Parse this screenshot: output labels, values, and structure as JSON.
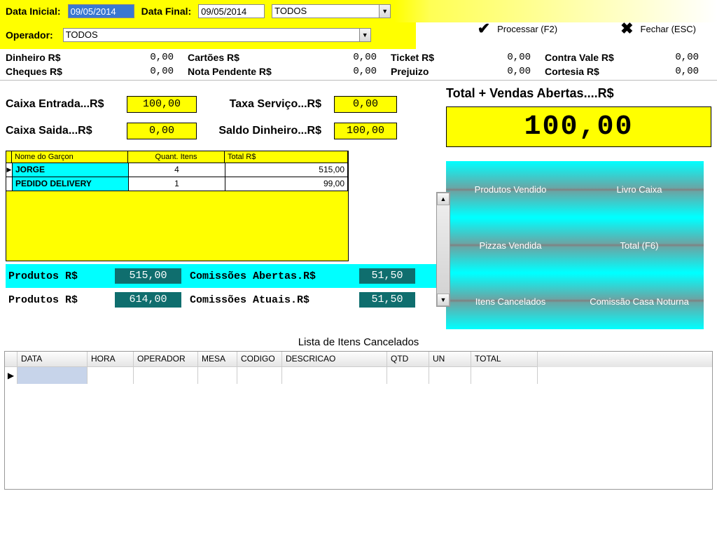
{
  "filters": {
    "data_inicial_label": "Data Inicial:",
    "data_inicial_value": "09/05/2014",
    "data_final_label": "Data Final:",
    "data_final_value": "09/05/2014",
    "tipo_value": "TODOS",
    "operador_label": "Operador:",
    "operador_value": "TODOS"
  },
  "actions": {
    "processar": "Processar (F2)",
    "fechar": "Fechar (ESC)"
  },
  "totals": {
    "dinheiro_lbl": "Dinheiro R$",
    "dinheiro_val": "0,00",
    "cheques_lbl": "Cheques R$",
    "cheques_val": "0,00",
    "cartoes_lbl": "Cartões R$",
    "cartoes_val": "0,00",
    "nota_lbl": "Nota Pendente R$",
    "nota_val": "0,00",
    "ticket_lbl": "Ticket R$",
    "ticket_val": "0,00",
    "prejuizo_lbl": "Prejuizo",
    "prejuizo_val": "0,00",
    "contravale_lbl": "Contra Vale R$",
    "contravale_val": "0,00",
    "cortesia_lbl": "Cortesia R$",
    "cortesia_val": "0,00"
  },
  "caixa": {
    "entrada_lbl": "Caixa Entrada...R$",
    "entrada_val": "100,00",
    "saida_lbl": "Caixa Saida...R$",
    "saida_val": "0,00",
    "taxa_lbl": "Taxa Serviço...R$",
    "taxa_val": "0,00",
    "saldo_lbl": "Saldo Dinheiro...R$",
    "saldo_val": "100,00"
  },
  "open_total": {
    "label": "Total + Vendas Abertas....R$",
    "value": "100,00"
  },
  "garcon_grid": {
    "hdr_nome": "Nome do Garçon",
    "hdr_qtd": "Quant. Itens",
    "hdr_total": "Total R$",
    "rows": [
      {
        "nome": "JORGE",
        "qtd": "4",
        "total": "515,00"
      },
      {
        "nome": "PEDIDO DELIVERY",
        "qtd": "1",
        "total": "99,00"
      }
    ]
  },
  "products": {
    "p1_lbl": "Produtos R$",
    "p1_val": "515,00",
    "c1_lbl": "Comissões Abertas.R$",
    "c1_val": "51,50",
    "p2_lbl": "Produtos R$",
    "p2_val": "614,00",
    "c2_lbl": "Comissões Atuais.R$",
    "c2_val": "51,50"
  },
  "panel_buttons": {
    "b1": "Produtos Vendido",
    "b2": "Livro Caixa",
    "b3": "Pizzas Vendida",
    "b4": "Total (F6)",
    "b5": "Itens Cancelados",
    "b6": "Comissão Casa Noturna"
  },
  "cancel_list": {
    "title": "Lista de Itens Cancelados",
    "cols": {
      "data": "DATA",
      "hora": "HORA",
      "oper": "OPERADOR",
      "mesa": "MESA",
      "cod": "CODIGO",
      "desc": "DESCRICAO",
      "qtd": "QTD",
      "un": "UN",
      "total": "TOTAL"
    }
  }
}
